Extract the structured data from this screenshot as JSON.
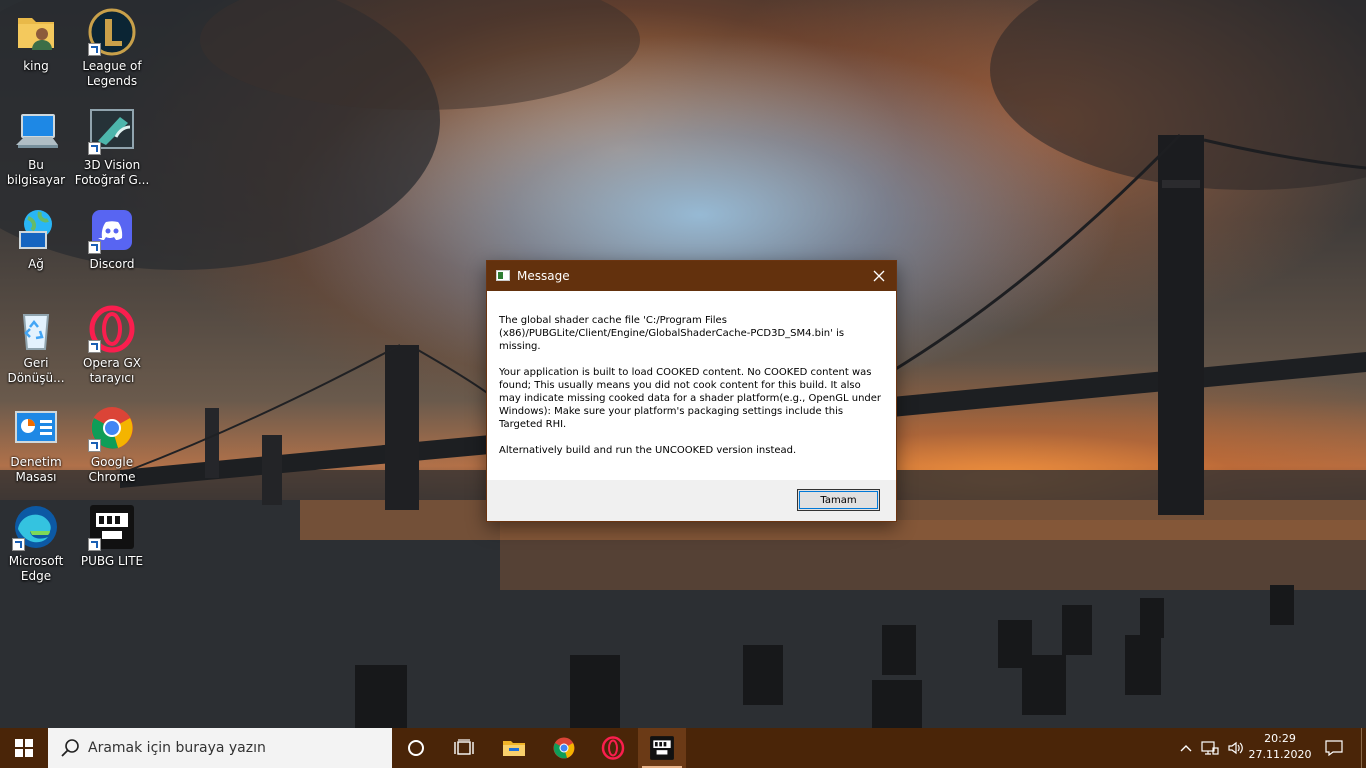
{
  "desktop_icons": [
    {
      "label": "king",
      "icon": "user-folder-icon"
    },
    {
      "label": "League of\nLegends",
      "icon": "league-of-legends-icon"
    },
    {
      "label": "Bu bilgisayar",
      "icon": "this-pc-icon"
    },
    {
      "label": "3D Vision\nFotoğraf G...",
      "icon": "3d-vision-icon"
    },
    {
      "label": "Ağ",
      "icon": "network-icon"
    },
    {
      "label": "Discord",
      "icon": "discord-icon"
    },
    {
      "label": "Geri\nDönüşü...",
      "icon": "recycle-bin-icon"
    },
    {
      "label": "Opera GX\ntarayıcı",
      "icon": "opera-gx-icon"
    },
    {
      "label": "Denetim\nMasası",
      "icon": "control-panel-icon"
    },
    {
      "label": "Google\nChrome",
      "icon": "chrome-icon"
    },
    {
      "label": "Microsoft\nEdge",
      "icon": "edge-icon"
    },
    {
      "label": "PUBG LITE",
      "icon": "pubg-lite-icon"
    }
  ],
  "dialog": {
    "title": "Message",
    "paragraphs": [
      "The global shader cache file 'C:/Program Files (x86)/PUBGLite/Client/Engine/GlobalShaderCache-PCD3D_SM4.bin' is missing.",
      "Your application is built to load COOKED content. No COOKED content was found; This usually means you did not cook content for this build. It also may indicate missing cooked data for a shader platform(e.g., OpenGL under Windows): Make sure your platform's packaging settings include this Targeted RHI.",
      "Alternatively build and run the UNCOOKED version instead."
    ],
    "ok_label": "Tamam"
  },
  "taskbar": {
    "search_placeholder": "Aramak için buraya yazın",
    "pinned": [
      "cortana-icon",
      "task-view-icon",
      "file-explorer-icon",
      "chrome-icon",
      "opera-gx-icon",
      "pubg-lite-icon"
    ],
    "time": "20:29",
    "date": "27.11.2020"
  },
  "colors": {
    "taskbar": "#4a2508",
    "dialog_titlebar": "#63310d",
    "accent": "#0078d7"
  }
}
